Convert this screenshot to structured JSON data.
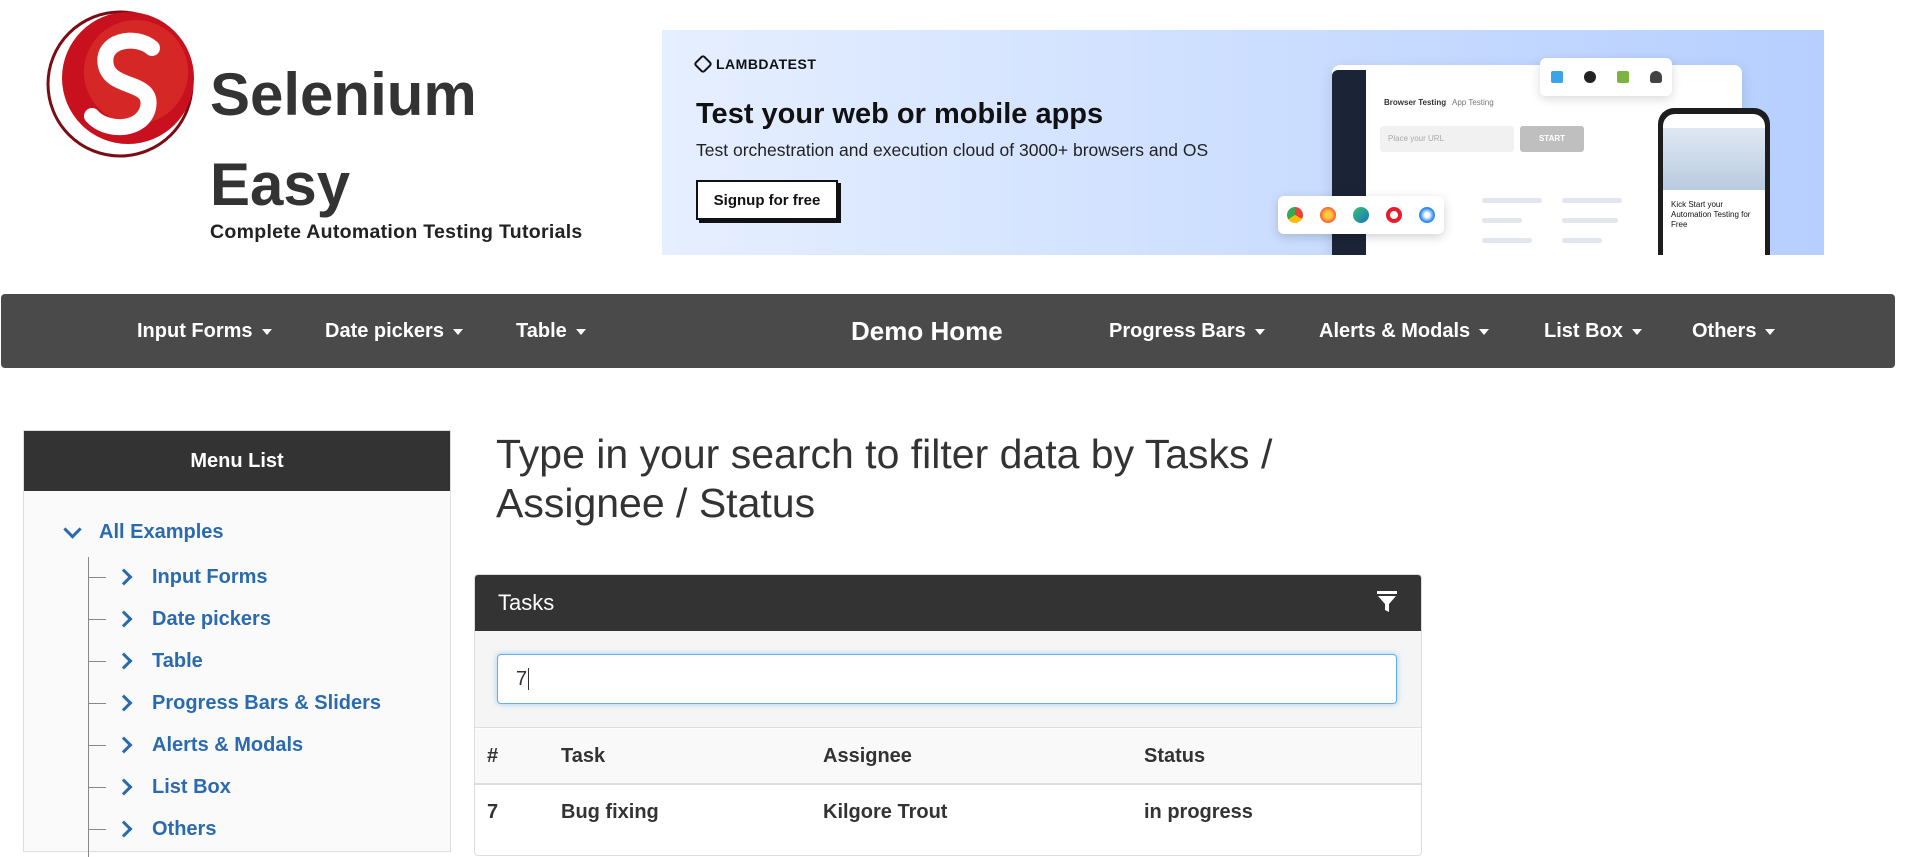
{
  "brand": {
    "title": "Selenium Easy",
    "subtitle": "Complete Automation Testing Tutorials"
  },
  "ad": {
    "logo_text": "LAMBDATEST",
    "headline": "Test your web or mobile apps",
    "subline": "Test orchestration and execution cloud of 3000+ browsers and OS",
    "cta": "Signup for free",
    "mock_tab_browser": "Browser Testing",
    "mock_tab_app": "App Testing",
    "mock_url_placeholder": "Place your URL",
    "mock_start": "START",
    "phone_text": "Kick Start your Automation Testing for Free"
  },
  "nav": {
    "input_forms": "Input Forms",
    "date_pickers": "Date pickers",
    "table": "Table",
    "demo_home": "Demo Home",
    "progress_bars": "Progress Bars",
    "alerts_modals": "Alerts & Modals",
    "list_box": "List Box",
    "others": "Others"
  },
  "sidebar": {
    "heading": "Menu List",
    "root": "All Examples",
    "items": [
      "Input Forms",
      "Date pickers",
      "Table",
      "Progress Bars & Sliders",
      "Alerts & Modals",
      "List Box",
      "Others"
    ]
  },
  "main": {
    "title": "Type in your search to filter data by Tasks / Assignee / Status",
    "panel_title": "Tasks",
    "search_value": "7",
    "columns": [
      "#",
      "Task",
      "Assignee",
      "Status"
    ],
    "rows": [
      [
        "7",
        "Bug fixing",
        "Kilgore Trout",
        "in progress"
      ]
    ]
  },
  "colors": {
    "navbar": "#4a4a4a",
    "panel_header": "#333333",
    "link": "#2a6bb0",
    "logo_red": "#c8101e",
    "search_focus": "#66afe9"
  },
  "icons": {
    "filter": "filter-icon",
    "caret": "caret-down-icon",
    "tree_expand": "chevron-right-icon",
    "tree_collapse": "chevron-down-icon"
  }
}
